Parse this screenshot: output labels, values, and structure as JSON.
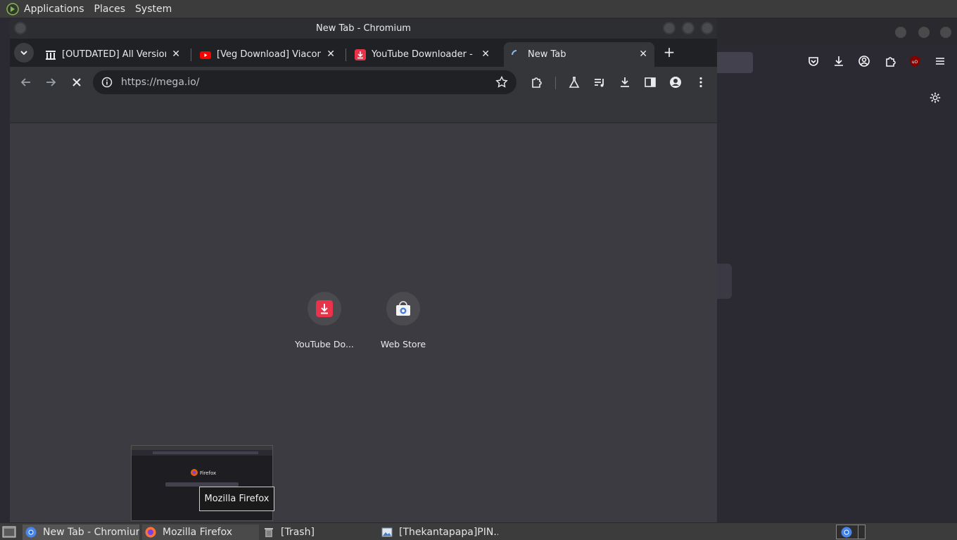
{
  "top_panel": {
    "menus": [
      "Applications",
      "Places",
      "System"
    ]
  },
  "chromium": {
    "window_title": "New Tab - Chromium",
    "tabs": [
      {
        "label": "[OUTDATED] All Versions",
        "favicon": "archive-icon"
      },
      {
        "label": "[Veg Download] Viacom I",
        "favicon": "youtube-icon"
      },
      {
        "label": "YouTube Downloader - Do",
        "favicon": "download-icon"
      },
      {
        "label": "New Tab",
        "favicon": "loading-spinner-icon",
        "active": true
      }
    ],
    "url": "https://mega.io/",
    "shortcuts": [
      {
        "label": "YouTube Do...",
        "icon": "youtube-downloader-icon",
        "color": "#e8334a"
      },
      {
        "label": "Web Store",
        "icon": "web-store-icon",
        "color": "#4a7fd6"
      }
    ]
  },
  "preview": {
    "tooltip": "Mozilla Firefox",
    "thumb_text": "Firefox"
  },
  "taskbar": {
    "tasks": [
      {
        "label": "New Tab - Chromium",
        "icon": "chromium-icon"
      },
      {
        "label": "Mozilla Firefox",
        "icon": "firefox-icon"
      },
      {
        "label": "[Trash]",
        "icon": "trash-icon"
      },
      {
        "label": "[Thekantapapa]PIN...",
        "icon": "image-viewer-icon"
      }
    ]
  },
  "colors": {
    "panel": "#3c3c3c",
    "chromium_frame": "#202124",
    "chromium_toolbar": "#35363a",
    "ntp_background": "#3c3b41",
    "firefox_background": "#1c1b22"
  }
}
